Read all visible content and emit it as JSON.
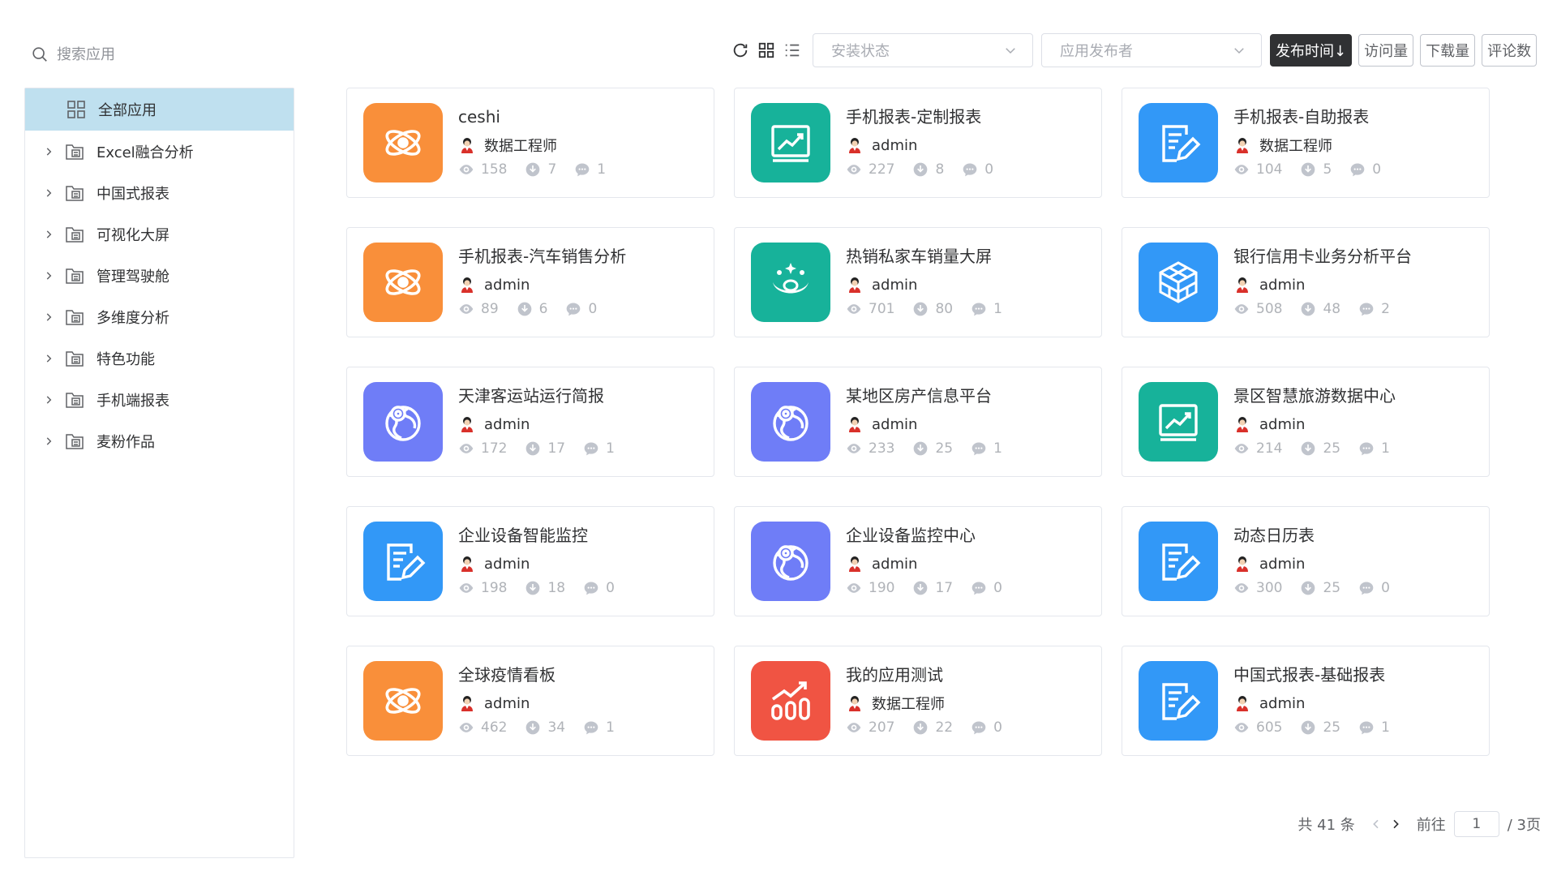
{
  "search": {
    "placeholder": "搜索应用"
  },
  "sidebar": {
    "items": [
      {
        "label": "全部应用",
        "active": true,
        "expandable": false
      },
      {
        "label": "Excel融合分析",
        "active": false,
        "expandable": true
      },
      {
        "label": "中国式报表",
        "active": false,
        "expandable": true
      },
      {
        "label": "可视化大屏",
        "active": false,
        "expandable": true
      },
      {
        "label": "管理驾驶舱",
        "active": false,
        "expandable": true
      },
      {
        "label": "多维度分析",
        "active": false,
        "expandable": true
      },
      {
        "label": "特色功能",
        "active": false,
        "expandable": true
      },
      {
        "label": "手机端报表",
        "active": false,
        "expandable": true
      },
      {
        "label": "麦粉作品",
        "active": false,
        "expandable": true
      }
    ]
  },
  "toolbar": {
    "install_status": {
      "placeholder": "安装状态"
    },
    "publisher": {
      "placeholder": "应用发布者"
    },
    "sort_buttons": [
      {
        "label": "发布时间↓",
        "active": true
      },
      {
        "label": "访问量",
        "active": false
      },
      {
        "label": "下载量",
        "active": false
      },
      {
        "label": "评论数",
        "active": false
      }
    ]
  },
  "colors": {
    "orange": "#f98f3a",
    "teal": "#17b29a",
    "blue": "#3298f7",
    "purple": "#6f7df7",
    "red": "#f05443"
  },
  "apps": [
    {
      "title": "ceshi",
      "author": "数据工程师",
      "views": "158",
      "downloads": "7",
      "comments": "1",
      "icon": "atom-icon",
      "color": "orange"
    },
    {
      "title": "手机报表-定制报表",
      "author": "admin",
      "views": "227",
      "downloads": "8",
      "comments": "0",
      "icon": "trend-screen-icon",
      "color": "teal"
    },
    {
      "title": "手机报表-自助报表",
      "author": "数据工程师",
      "views": "104",
      "downloads": "5",
      "comments": "0",
      "icon": "edit-doc-icon",
      "color": "blue"
    },
    {
      "title": "手机报表-汽车销售分析",
      "author": "admin",
      "views": "89",
      "downloads": "6",
      "comments": "0",
      "icon": "atom-icon",
      "color": "orange"
    },
    {
      "title": "热销私家车销量大屏",
      "author": "admin",
      "views": "701",
      "downloads": "80",
      "comments": "1",
      "icon": "smile-icon",
      "color": "teal"
    },
    {
      "title": "银行信用卡业务分析平台",
      "author": "admin",
      "views": "508",
      "downloads": "48",
      "comments": "2",
      "icon": "cubes-icon",
      "color": "blue"
    },
    {
      "title": "天津客运站运行简报",
      "author": "admin",
      "views": "172",
      "downloads": "17",
      "comments": "1",
      "icon": "globe-pin-icon",
      "color": "purple"
    },
    {
      "title": "某地区房产信息平台",
      "author": "admin",
      "views": "233",
      "downloads": "25",
      "comments": "1",
      "icon": "globe-pin-icon",
      "color": "purple"
    },
    {
      "title": "景区智慧旅游数据中心",
      "author": "admin",
      "views": "214",
      "downloads": "25",
      "comments": "1",
      "icon": "trend-screen-icon",
      "color": "teal"
    },
    {
      "title": "企业设备智能监控",
      "author": "admin",
      "views": "198",
      "downloads": "18",
      "comments": "0",
      "icon": "edit-doc-icon",
      "color": "blue"
    },
    {
      "title": "企业设备监控中心",
      "author": "admin",
      "views": "190",
      "downloads": "17",
      "comments": "0",
      "icon": "globe-pin-icon",
      "color": "purple"
    },
    {
      "title": "动态日历表",
      "author": "admin",
      "views": "300",
      "downloads": "25",
      "comments": "0",
      "icon": "edit-doc-icon",
      "color": "blue"
    },
    {
      "title": "全球疫情看板",
      "author": "admin",
      "views": "462",
      "downloads": "34",
      "comments": "1",
      "icon": "atom-icon",
      "color": "orange"
    },
    {
      "title": "我的应用测试",
      "author": "数据工程师",
      "views": "207",
      "downloads": "22",
      "comments": "0",
      "icon": "bar-growth-icon",
      "color": "red"
    },
    {
      "title": "中国式报表-基础报表",
      "author": "admin",
      "views": "605",
      "downloads": "25",
      "comments": "1",
      "icon": "edit-doc-icon",
      "color": "blue"
    }
  ],
  "pagination": {
    "total_text": "共 41 条",
    "goto_label": "前往",
    "current_page": "1",
    "total_pages_text": "/ 3页"
  }
}
